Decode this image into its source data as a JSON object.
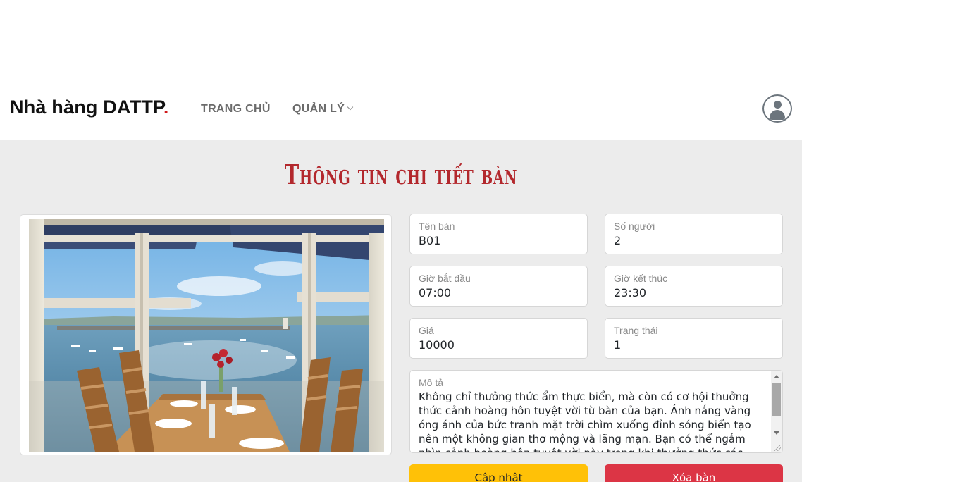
{
  "navbar": {
    "brand": "Nhà hàng DATTP",
    "brand_dot": ".",
    "links": {
      "home": "TRANG CHỦ",
      "manage": "QUẢN LÝ"
    }
  },
  "page": {
    "title": "Thông tin chi tiết bàn"
  },
  "form": {
    "name": {
      "label": "Tên bàn",
      "value": "B01"
    },
    "people": {
      "label": "Số người",
      "value": "2"
    },
    "start": {
      "label": "Giờ bắt đầu",
      "value": "07:00"
    },
    "end": {
      "label": "Giờ kết thúc",
      "value": "23:30"
    },
    "price": {
      "label": "Giá",
      "value": "10000"
    },
    "status": {
      "label": "Trạng thái",
      "value": "1"
    },
    "description": {
      "label": "Mô tả",
      "value": "Không chỉ thưởng thức ẩm thực biển, mà còn có cơ hội thưởng thức cảnh hoàng hôn tuyệt vời từ bàn của bạn. Ánh nắng vàng óng ánh của bức tranh mặt trời chìm xuống đỉnh sóng biển tạo nên một không gian thơ mộng và lãng mạn. Bạn có thể ngắm nhìn cảnh hoàng hôn tuyệt vời này trong khi thưởng thức các"
    }
  },
  "buttons": {
    "update": "Cập nhật",
    "delete": "Xóa bàn"
  },
  "colors": {
    "accent_red": "#b3282d",
    "update": "#ffc107",
    "delete": "#dc3545",
    "panel_bg": "#ececec"
  },
  "icons": {
    "avatar": "user-circle-icon",
    "dropdown": "chevron-down-icon"
  }
}
